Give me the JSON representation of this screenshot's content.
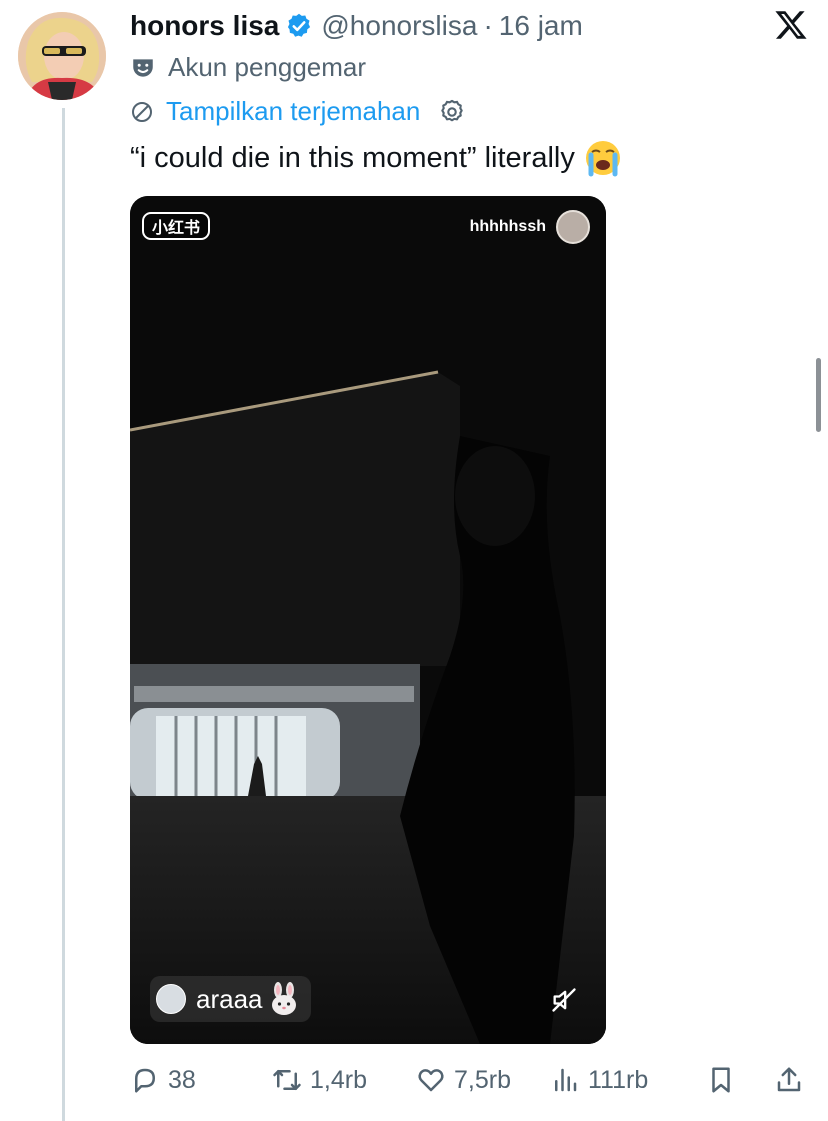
{
  "tweet": {
    "author": {
      "display_name": "honors lisa",
      "handle": "@honorslisa",
      "separator": "·",
      "time": "16 jam",
      "label": "Akun penggemar"
    },
    "translate_label": "Tampilkan terjemahan",
    "text": "“i could die in this moment” literally",
    "text_emoji": "loudly-crying-face-icon"
  },
  "media": {
    "watermark": "小红书",
    "uploader": "hhhhhssh",
    "audio_label": "araaa",
    "audio_emoji": "rabbit-face-icon",
    "mute_icon": "speaker-muted-icon"
  },
  "actions": {
    "replies": "38",
    "retweets": "1,4rb",
    "likes": "7,5rb",
    "views": "111rb"
  },
  "colors": {
    "accent": "#1d9bf0",
    "secondary_text": "#536471",
    "primary_text": "#0f1419",
    "thread_line": "#cfd9de"
  }
}
